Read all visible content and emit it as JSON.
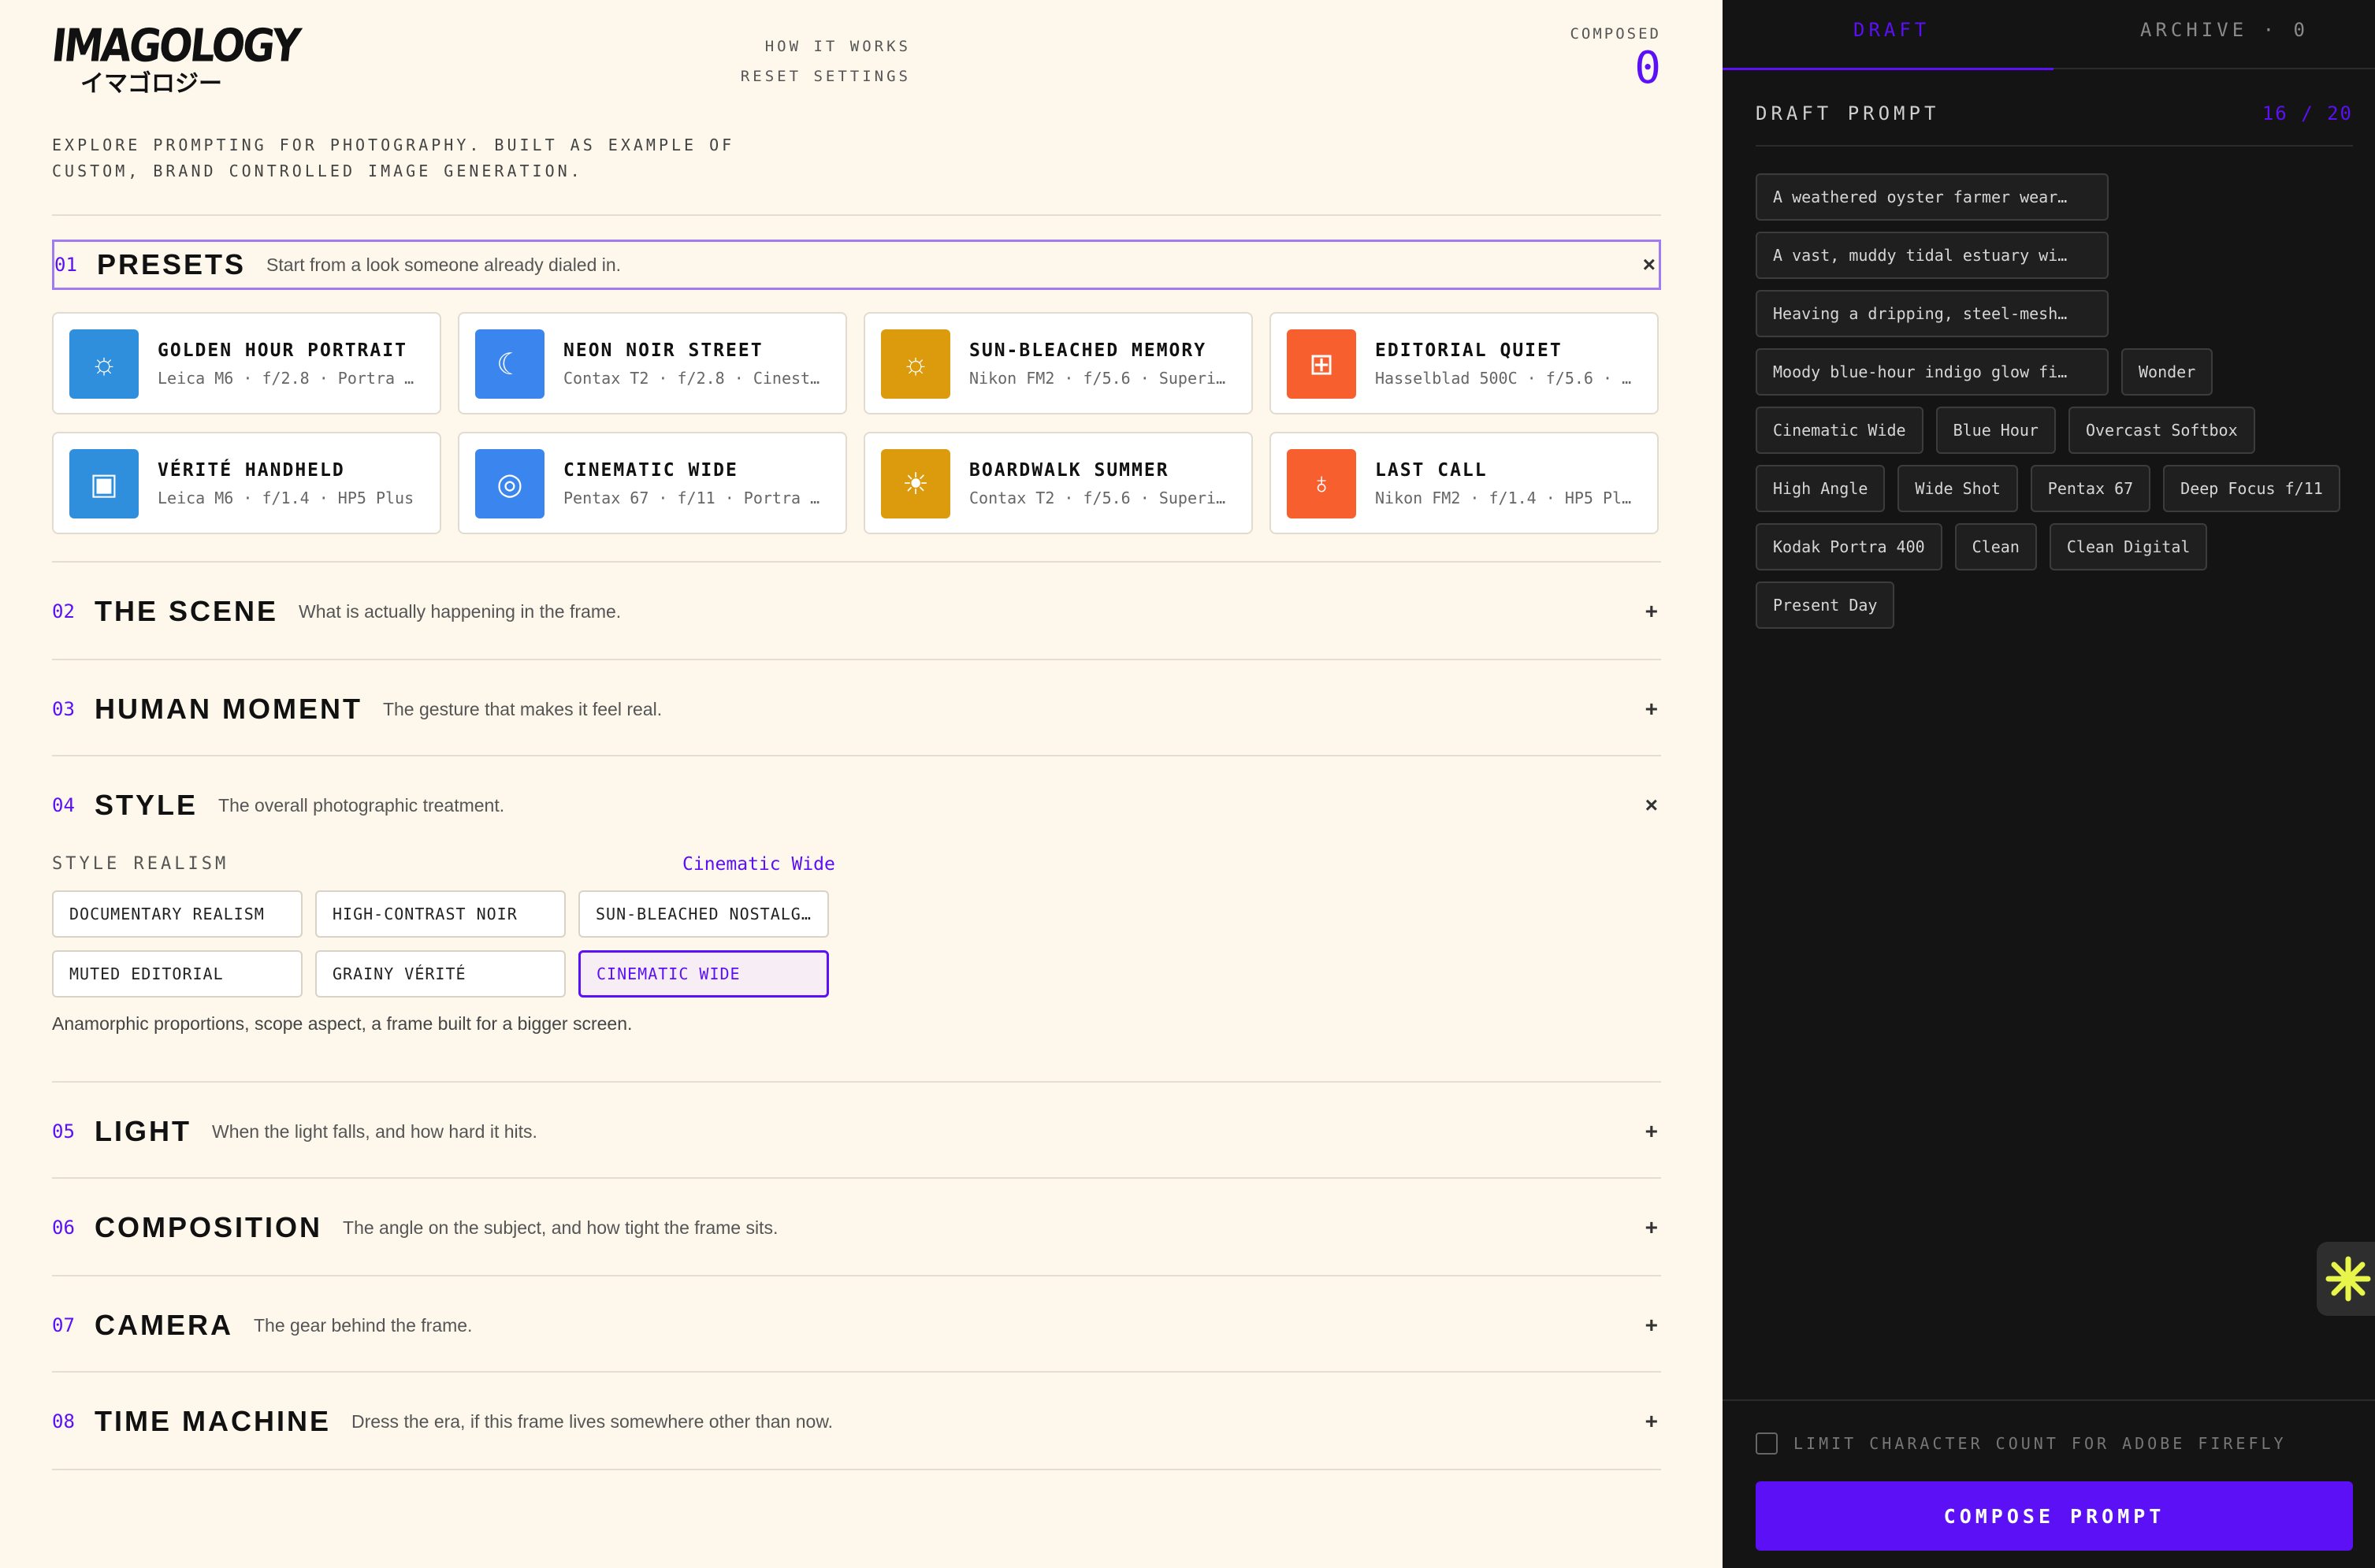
{
  "brand": {
    "logo_en": "IMAGOLOGY",
    "logo_jp": "イマゴロジー",
    "tagline": "EXPLORE PROMPTING FOR PHOTOGRAPHY. BUILT AS EXAMPLE OF CUSTOM, BRAND CONTROLLED IMAGE GENERATION."
  },
  "nav": {
    "how": "HOW IT WORKS",
    "reset": "RESET SETTINGS"
  },
  "composed": {
    "label": "COMPOSED",
    "count": "0"
  },
  "sections": [
    {
      "index": "01",
      "title": "PRESETS",
      "subtitle": "Start from a look someone already dialed in.",
      "toggle": "×"
    },
    {
      "index": "02",
      "title": "THE SCENE",
      "subtitle": "What is actually happening in the frame.",
      "toggle": "+"
    },
    {
      "index": "03",
      "title": "HUMAN MOMENT",
      "subtitle": "The gesture that makes it feel real.",
      "toggle": "+"
    },
    {
      "index": "04",
      "title": "STYLE",
      "subtitle": "The overall photographic treatment.",
      "toggle": "×"
    },
    {
      "index": "05",
      "title": "LIGHT",
      "subtitle": "When the light falls, and how hard it hits.",
      "toggle": "+"
    },
    {
      "index": "06",
      "title": "COMPOSITION",
      "subtitle": "The angle on the subject, and how tight the frame sits.",
      "toggle": "+"
    },
    {
      "index": "07",
      "title": "CAMERA",
      "subtitle": "The gear behind the frame.",
      "toggle": "+"
    },
    {
      "index": "08",
      "title": "TIME MACHINE",
      "subtitle": "Dress the era, if this frame lives somewhere other than now.",
      "toggle": "+"
    }
  ],
  "presets": [
    {
      "name": "GOLDEN HOUR PORTRAIT",
      "meta": "Leica M6 · f/2.8 · Portra …",
      "icon": "☼",
      "icon_name": "sun-icon",
      "color": "#2f8fdc"
    },
    {
      "name": "NEON NOIR STREET",
      "meta": "Contax T2 · f/2.8 · Cinest…",
      "icon": "☾",
      "icon_name": "moon-icon",
      "color": "#3a86ee"
    },
    {
      "name": "SUN-BLEACHED MEMORY",
      "meta": "Nikon FM2 · f/5.6 · Superi…",
      "icon": "☼",
      "icon_name": "sun-icon",
      "color": "#db9b0c"
    },
    {
      "name": "EDITORIAL QUIET",
      "meta": "Hasselblad 500C · f/5.6 · …",
      "icon": "⊞",
      "icon_name": "grid-icon",
      "color": "#f85f2f"
    },
    {
      "name": "VÉRITÉ HANDHELD",
      "meta": "Leica M6 · f/1.4 · HP5 Plus",
      "icon": "▣",
      "icon_name": "film-icon",
      "color": "#2f8fdc"
    },
    {
      "name": "CINEMATIC WIDE",
      "meta": "Pentax 67 · f/11 · Portra …",
      "icon": "◎",
      "icon_name": "ring-icon",
      "color": "#3a86ee"
    },
    {
      "name": "BOARDWALK SUMMER",
      "meta": "Contax T2 · f/5.6 · Superi…",
      "icon": "☀",
      "icon_name": "sun-icon",
      "color": "#db9b0c"
    },
    {
      "name": "LAST CALL",
      "meta": "Nikon FM2 · f/1.4 · HP5 Pl…",
      "icon": "♁",
      "icon_name": "bulb-icon",
      "color": "#f85f2f"
    }
  ],
  "style": {
    "group_label": "STYLE REALISM",
    "selected_value": "Cinematic Wide",
    "options": [
      "DOCUMENTARY REALISM",
      "HIGH-CONTRAST NOIR",
      "SUN-BLEACHED NOSTALG…",
      "MUTED EDITORIAL",
      "GRAINY VÉRITÉ",
      "CINEMATIC WIDE"
    ],
    "description": "Anamorphic proportions, scope aspect, a frame built for a bigger screen."
  },
  "panel": {
    "tab_draft": "DRAFT",
    "tab_archive": "ARCHIVE · 0",
    "heading": "DRAFT PROMPT",
    "count": "16 / 20",
    "chips": [
      "A weathered oyster farmer wear…",
      "A vast, muddy tidal estuary wi…",
      "Heaving a dripping, steel-mesh…",
      "Moody blue-hour indigo glow fi…",
      "Wonder",
      "Cinematic Wide",
      "Blue Hour",
      "Overcast Softbox",
      "High Angle",
      "Wide Shot",
      "Pentax 67",
      "Deep Focus f/11",
      "Kodak Portra 400",
      "Clean",
      "Clean Digital",
      "Present Day"
    ],
    "limit_label": "LIMIT CHARACTER COUNT FOR ADOBE FIREFLY",
    "compose_label": "COMPOSE PROMPT"
  }
}
